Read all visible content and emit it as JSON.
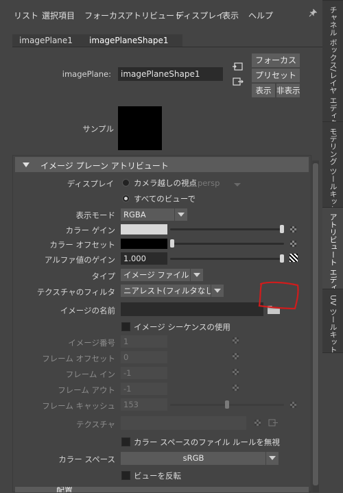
{
  "menu": [
    "リスト",
    "選択項目",
    "フォーカス",
    "アトリビュート",
    "ディスプレイ",
    "表示",
    "ヘルプ"
  ],
  "tabs": [
    "imagePlane1",
    "imagePlaneShape1"
  ],
  "node": {
    "label": "imagePlane:",
    "value": "imagePlaneShape1"
  },
  "buttons": {
    "focus": "フォーカス",
    "preset": "プリセット",
    "show": "表示",
    "hide": "非表示"
  },
  "sample_label": "サンプル",
  "section": {
    "title": "イメージ プレーン アトリビュート",
    "next_title": "配置"
  },
  "display": {
    "label": "ディスプレイ",
    "option1": "カメラ越しの視点",
    "option1_camera": "persp",
    "option2": "すべてのビューで",
    "selected": 2
  },
  "display_mode": {
    "label": "表示モード",
    "value": "RGBA"
  },
  "color_gain": {
    "label": "カラー ゲイン",
    "level": 1.0
  },
  "color_offset": {
    "label": "カラー オフセット",
    "level": 0.0
  },
  "alpha_gain": {
    "label": "アルファ値のゲイン",
    "value": "1.000",
    "level": 1.0
  },
  "type": {
    "label": "タイプ",
    "value": "イメージ ファイル"
  },
  "texture_filter": {
    "label": "テクスチャのフィルタ",
    "value": "ニアレスト(フィルタなし)"
  },
  "image_name": {
    "label": "イメージの名前",
    "value": ""
  },
  "use_sequence": {
    "label": "イメージ シーケンスの使用",
    "checked": false
  },
  "image_number": {
    "label": "イメージ番号",
    "value": "1"
  },
  "frame_offset": {
    "label": "フレーム オフセット",
    "value": "0"
  },
  "frame_in": {
    "label": "フレーム イン",
    "value": "-1"
  },
  "frame_out": {
    "label": "フレーム アウト",
    "value": "-1"
  },
  "frame_cache": {
    "label": "フレーム キャッシュ",
    "value": "153",
    "level": 0.5
  },
  "texture": {
    "label": "テクスチャ",
    "value": ""
  },
  "ignore_color_space": {
    "label": "カラー スペースのファイル ルールを無視",
    "checked": false
  },
  "color_space": {
    "label": "カラー スペース",
    "value": "sRGB"
  },
  "flip_view": {
    "label": "ビューを反転",
    "checked": false
  },
  "side_tabs": [
    "チャネル ボックス/レイヤ エディタ",
    "モデリング ツールキット",
    "アトリビュート エディタ",
    "UV ツールキット"
  ],
  "colors": {
    "panel": "#444444",
    "field": "#2b2b2b",
    "annotation": "#d01c1c",
    "sample": "#000000"
  }
}
